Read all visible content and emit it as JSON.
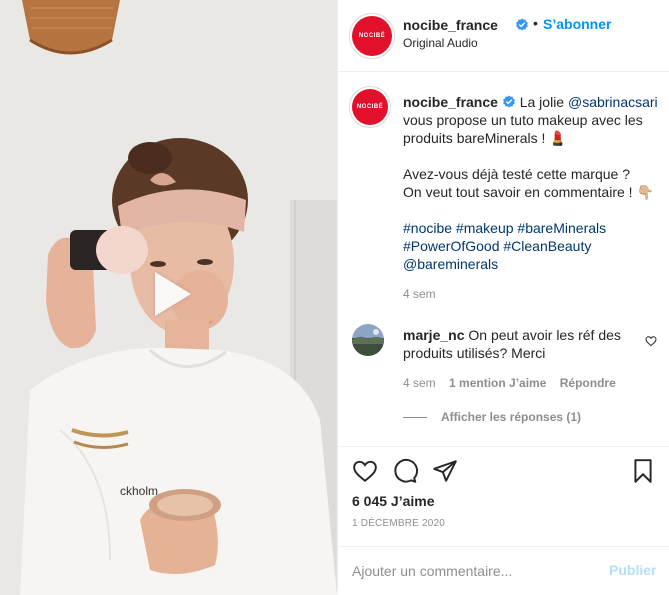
{
  "post": {
    "username": "nocibe_france",
    "avatar_text": "NOCIBÉ",
    "follow_label": "S’abonner",
    "dot": "•",
    "audio": "Original Audio"
  },
  "caption": {
    "username": "nocibe_france",
    "line1_text": "La jolie",
    "mention": "@sabrinacsari",
    "line2": "vous propose un tuto makeup avec les",
    "line3": "produits bareMinerals ! 💄",
    "line4": "Avez-vous déjà testé cette marque ?",
    "line5": "On veut tout savoir en commentaire ! 👇🏼",
    "hashtags_line1": "#nocibe #makeup #bareMinerals",
    "hashtags_line2": "#PowerOfGood #CleanBeauty",
    "mention2": "@bareminerals",
    "age": "4 sem"
  },
  "comment": {
    "username": "marje_nc",
    "text_l1": "On peut avoir les réf des",
    "text_l2": "produits utilisés? Merci",
    "age": "4 sem",
    "likes": "1 mention J’aime",
    "reply": "Répondre",
    "view_replies": "Afficher les réponses (1)"
  },
  "stats": {
    "likes": "6 045 J’aime",
    "date": "1 DÉCEMBRE 2020"
  },
  "composer": {
    "placeholder": "Ajouter un commentaire...",
    "publish": "Publier"
  },
  "colors": {
    "brand_red": "#e3102b",
    "link_blue": "#0095f6",
    "verified_blue": "#3897f0"
  }
}
